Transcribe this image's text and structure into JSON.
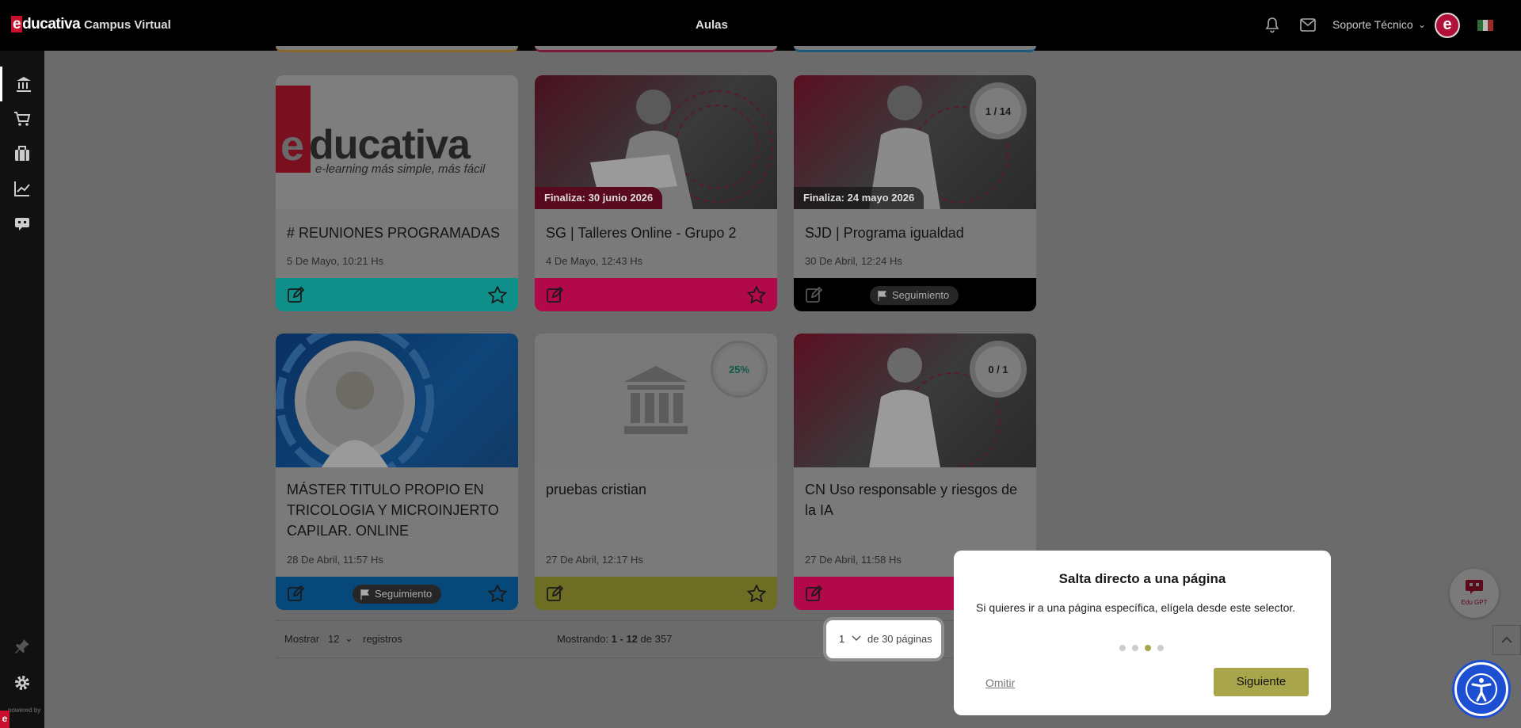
{
  "header": {
    "logo_text": "educativa",
    "campus_label": "Campus Virtual",
    "section_title": "Aulas",
    "user_name": "Soporte Técnico",
    "avatar_letter": "e",
    "icons": [
      "bell-icon",
      "mail-icon",
      "chevron-down-icon",
      "mexico-flag-icon"
    ]
  },
  "sidebar": {
    "items": [
      {
        "icon": "institution-icon"
      },
      {
        "icon": "cart-icon"
      },
      {
        "icon": "briefcase-icon"
      },
      {
        "icon": "chart-icon"
      },
      {
        "icon": "bot-icon"
      }
    ],
    "bottom_icons": [
      "pin-icon",
      "gear-icon"
    ],
    "powered_by": "powered by"
  },
  "cards": [
    {
      "title": "# REUNIONES PROGRAMADAS",
      "date": "5 De Mayo, 10:21 Hs",
      "logo_text": "ducativa",
      "logo_tagline": "e-learning más simple, más fácil",
      "footer_color": "#0f8f8a",
      "favorite": true
    },
    {
      "title": "SG | Talleres Online - Grupo 2",
      "date": "4 De Mayo, 12:43 Hs",
      "badge": "Finaliza: 30 junio 2026",
      "footer_color": "#b2094a",
      "favorite": true
    },
    {
      "title": "SJD | Programa igualdad",
      "date": "30 De Abril, 12:24 Hs",
      "badge": "Finaliza: 24 mayo 2026",
      "progress": "1 / 14",
      "footer_color": "#000000",
      "seguimiento": "Seguimiento"
    },
    {
      "title": "MÁSTER TITULO PROPIO EN TRICOLOGIA Y MICROINJERTO CAPILAR. ONLINE",
      "date": "28 De Abril, 11:57 Hs",
      "footer_color": "#07487a",
      "seguimiento": "Seguimiento",
      "favorite": true
    },
    {
      "title": "pruebas cristian",
      "date": "27 De Abril, 12:17 Hs",
      "progress": "25%",
      "footer_color": "#6e6d24",
      "favorite": true
    },
    {
      "title": "CN Uso responsable y riesgos de la IA",
      "date": "27 De Abril, 11:58 Hs",
      "progress": "0 / 1",
      "footer_color": "#b2094a"
    }
  ],
  "pagination": {
    "show_label": "Mostrar",
    "per_page": "12",
    "records_label": "registros",
    "showing_prefix": "Mostrando:",
    "showing_range": "1 - 12",
    "showing_of": "de",
    "total": "357",
    "current_page": "1",
    "pages_label": "de 30 páginas"
  },
  "tour": {
    "title": "Salta directo a una página",
    "body": "Si quieres ir a una página específica, elígela desde este selector.",
    "steps_total": 4,
    "current_step": 3,
    "skip_label": "Omitir",
    "next_label": "Siguiente"
  },
  "widgets": {
    "edu_gpt_label": "Edu GPT",
    "icons": [
      "edu-gpt-icon",
      "chevron-up-icon",
      "accessibility-icon"
    ]
  }
}
